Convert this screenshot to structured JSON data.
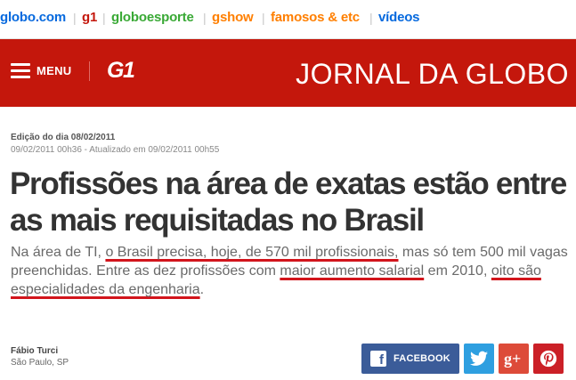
{
  "portal_nav": {
    "items": [
      {
        "label": "globo.com",
        "color": "#0669de"
      },
      {
        "label": "g1",
        "color": "#c4170c"
      },
      {
        "label": "globoesporte",
        "color": "#39a935"
      },
      {
        "label": "gshow",
        "color": "#ff7f00"
      },
      {
        "label": "famosos & etc",
        "color": "#ff7f00"
      },
      {
        "label": "vídeos",
        "color": "#0669de"
      }
    ]
  },
  "header": {
    "menu_label": "MENU",
    "logo_text": "G1",
    "program_title": "JORNAL DA GLOBO",
    "background_color": "#c4170c"
  },
  "article": {
    "edition": "Edição do dia 08/02/2011",
    "timestamps": "09/02/2011 00h36 - Atualizado em 09/02/2011 00h55",
    "headline": "Profissões na área de exatas estão entre as mais requisitadas no Brasil",
    "summary": {
      "p1": "Na área de TI, ",
      "h1": "o Brasil precisa, hoje, de 570 mil profissionais,",
      "p2": " mas só tem 500 mil vagas preenchidas. Entre as dez profissões com ",
      "h2": "maior aumento salarial",
      "p3": " em 2010, ",
      "h3": "oito são especialidades da engenharia",
      "p4": "."
    },
    "author": "Fábio Turci",
    "location": "São Paulo, SP"
  },
  "share": {
    "facebook_label": "FACEBOOK",
    "facebook_icon": "f",
    "googleplus_icon": "g+",
    "colors": {
      "facebook": "#3b5c99",
      "twitter": "#2e9fe0",
      "googleplus": "#dd4b39",
      "pinterest": "#cb2027"
    }
  }
}
